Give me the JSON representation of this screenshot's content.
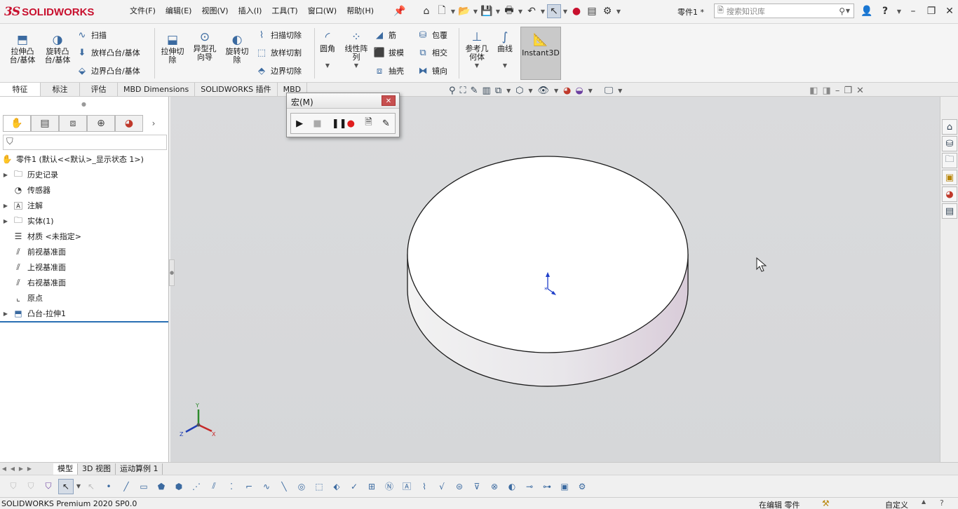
{
  "titlebar": {
    "logo_ds": "3S",
    "logo_text": "SOLIDWORKS",
    "menus": [
      "文件(F)",
      "编辑(E)",
      "视图(V)",
      "插入(I)",
      "工具(T)",
      "窗口(W)",
      "帮助(H)"
    ],
    "doc_name": "零件1 *",
    "search_placeholder": "搜索知识库"
  },
  "features": {
    "extrude_boss": "拉伸凸\n台/基体",
    "revolve_boss": "旋转凸\n台/基体",
    "sweep": "扫描",
    "loft": "放样凸台/基体",
    "boundary": "边界凸台/基体",
    "extrude_cut": "拉伸切\n除",
    "hole_wizard": "异型孔\n向导",
    "revolve_cut": "旋转切\n除",
    "swept_cut": "扫描切除",
    "lofted_cut": "放样切割",
    "boundary_cut": "边界切除",
    "fillet": "圆角",
    "linear_pattern": "线性阵\n列",
    "rib": "筋",
    "wrap": "包覆",
    "draft": "拔模",
    "intersect": "相交",
    "shell": "抽壳",
    "mirror": "镜向",
    "ref_geometry": "参考几\n何体",
    "curves": "曲线",
    "instant3d": "Instant3D"
  },
  "cmd_tabs": [
    "特征",
    "标注",
    "评估",
    "MBD Dimensions",
    "SOLIDWORKS 插件",
    "MBD"
  ],
  "macro": {
    "title": "宏(M)"
  },
  "tree": {
    "root": "零件1  (默认<<默认>_显示状态 1>)",
    "items": [
      {
        "label": "历史记录",
        "expand": true
      },
      {
        "label": "传感器",
        "expand": false
      },
      {
        "label": "注解",
        "expand": true
      },
      {
        "label": "实体(1)",
        "expand": true
      },
      {
        "label": "材质 <未指定>",
        "expand": false
      },
      {
        "label": "前视基准面",
        "expand": false
      },
      {
        "label": "上视基准面",
        "expand": false
      },
      {
        "label": "右视基准面",
        "expand": false
      },
      {
        "label": "原点",
        "expand": false
      },
      {
        "label": "凸台-拉伸1",
        "expand": true
      }
    ]
  },
  "bottom_tabs": [
    "模型",
    "3D 视图",
    "运动算例 1"
  ],
  "status": {
    "left": "SOLIDWORKS Premium 2020 SP0.0",
    "editing": "在编辑 零件",
    "custom": "自定义"
  },
  "triad": {
    "x": "X",
    "y": "Y",
    "z": "Z"
  },
  "colors": {
    "brand": "#c8102e",
    "accent": "#3b6aa0"
  }
}
